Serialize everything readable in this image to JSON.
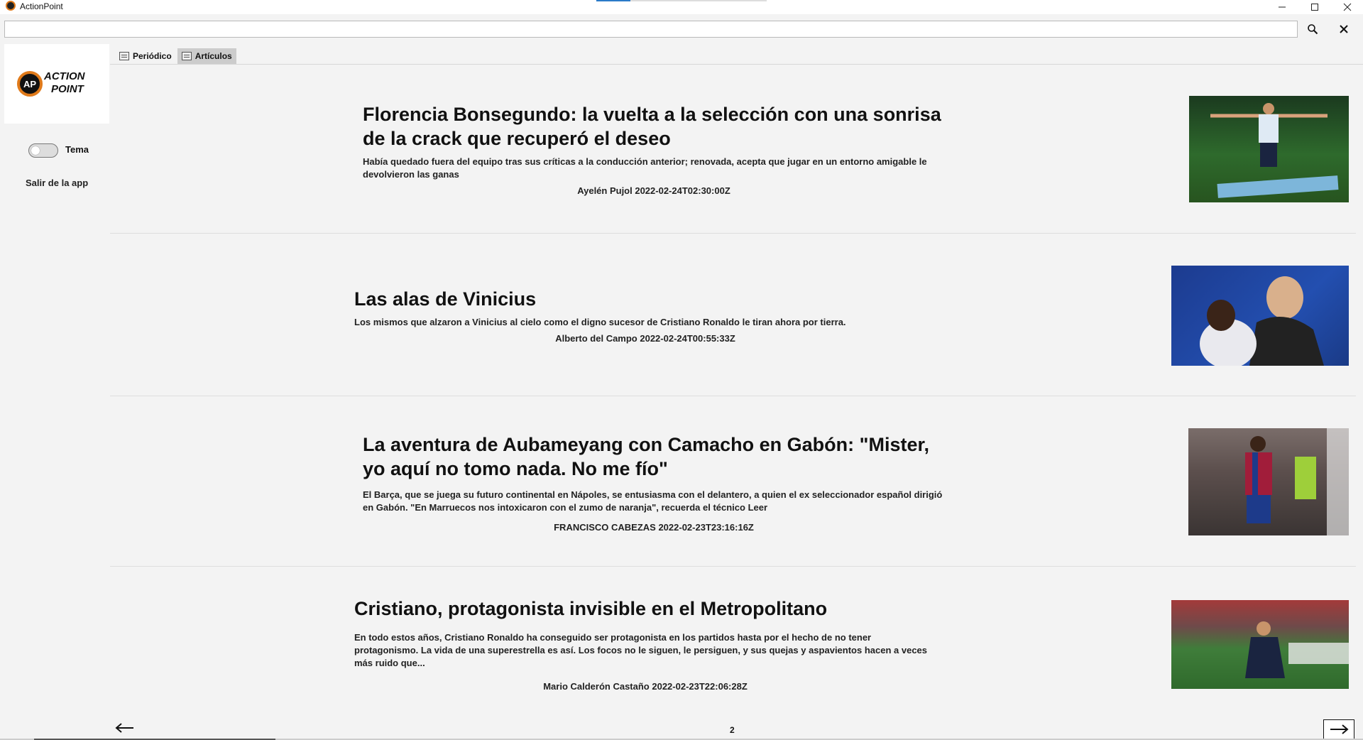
{
  "window": {
    "title": "ActionPoint",
    "minimize_icon": "minimize-icon",
    "maximize_icon": "maximize-icon",
    "close_icon": "window-close-icon"
  },
  "search": {
    "value": "",
    "placeholder": "",
    "search_icon": "magnifier-icon",
    "clear_icon": "close-icon"
  },
  "sidebar": {
    "logo_text_1": "ACTION",
    "logo_text_2": "POINT",
    "logo_initials": "AP",
    "theme_label": "Tema",
    "theme_on": false,
    "exit_label": "Salir de la app"
  },
  "tabs": [
    {
      "label": "Periódico",
      "icon": "newspaper-icon",
      "active": false
    },
    {
      "label": "Artículos",
      "icon": "articles-icon",
      "active": true
    }
  ],
  "articles": [
    {
      "headline": "Florencia Bonsegundo: la vuelta a la selección con una sonrisa de la crack que recuperó el deseo",
      "summary": "Había quedado fuera del equipo tras sus críticas a la conducción anterior; renovada, acepta que jugar en un entorno amigable le devolvieron las ganas",
      "byline": "Ayelén Pujol 2022-02-24T02:30:00Z"
    },
    {
      "headline": "Las alas de Vinicius",
      "summary": "Los mismos que alzaron a Vinicius al cielo como el digno sucesor de Cristiano Ronaldo le tiran ahora por tierra.",
      "byline": "Alberto del Campo 2022-02-24T00:55:33Z"
    },
    {
      "headline": "La aventura de Aubameyang con Camacho en Gabón: \"Mister, yo aquí no tomo nada. No me fío\"",
      "summary": "El Barça, que se juega su futuro continental en Nápoles, se entusiasma con el delantero, a quien el ex seleccionador español dirigió en Gabón. \"En Marruecos nos intoxicaron con el zumo de naranja\", recuerda el técnico Leer",
      "byline": "FRANCISCO CABEZAS 2022-02-23T23:16:16Z"
    },
    {
      "headline": "Cristiano, protagonista invisible en el Metropolitano",
      "summary": "En todo estos años, Cristiano Ronaldo ha conseguido ser protagonista en los partidos hasta por el hecho de no tener protagonismo. La vida de una superestrella es así. Los focos no le siguen, le persiguen, y sus quejas y aspavientos hacen a veces más ruido que...",
      "byline": "Mario Calderón Castaño 2022-02-23T22:06:28Z"
    }
  ],
  "pager": {
    "page": "2",
    "prev_icon": "arrow-left-icon",
    "next_icon": "arrow-right-icon"
  }
}
